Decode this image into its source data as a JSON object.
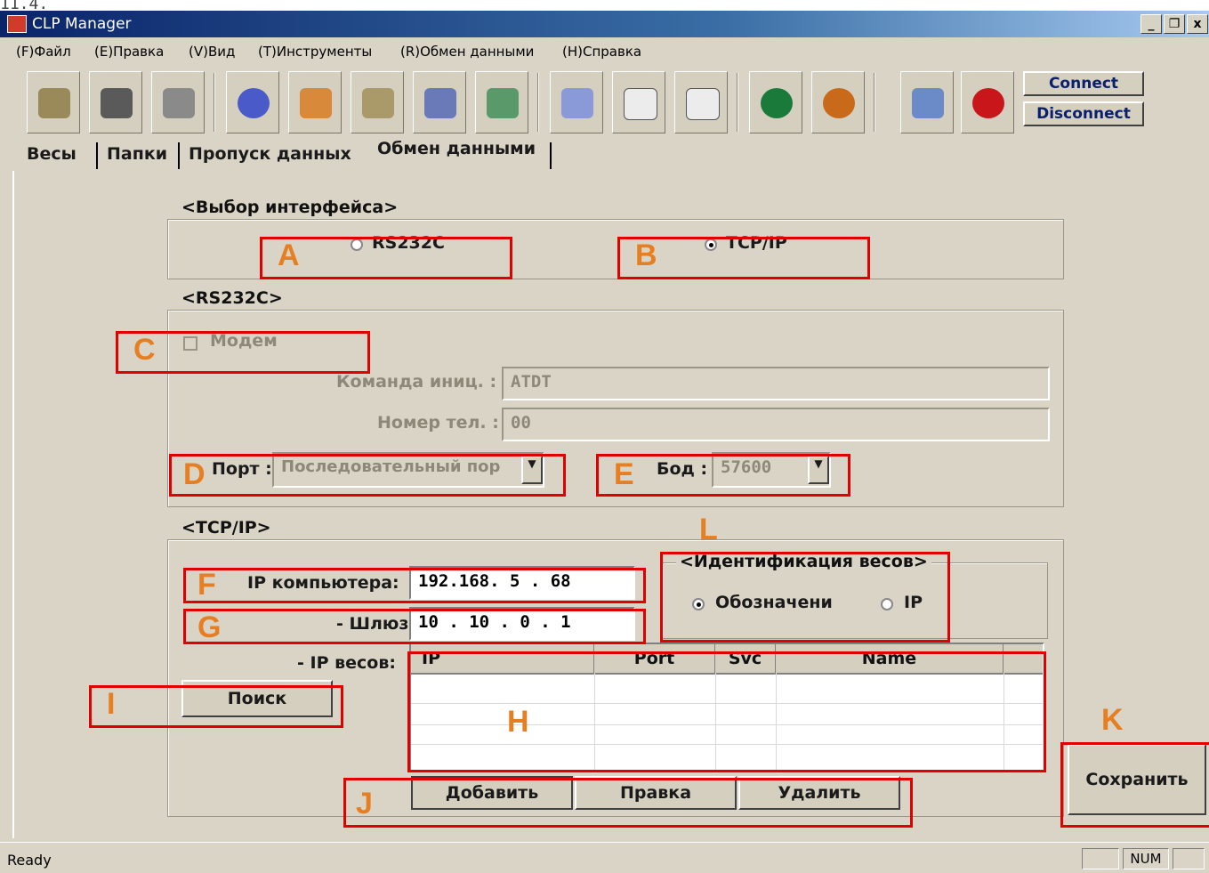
{
  "top_note": "11.4.",
  "window": {
    "title": "CLP Manager",
    "controls": [
      "_",
      "ن",
      "x"
    ]
  },
  "menu": [
    "(F)Файл",
    "(E)Правка",
    "(V)Вид",
    "(T)Инструменты",
    "(R)Обмен данными",
    "(H)Справка"
  ],
  "toolbar": {
    "connect_label": "Connect",
    "disconnect_label": "Disconnect"
  },
  "tabs": [
    "Весы",
    "Папки",
    "Пропуск данных",
    "Обмен данными"
  ],
  "interface_group": {
    "legend": "<Выбор интерфейса>",
    "rs232c_label": "RS232C",
    "tcpip_label": "TCP/IP",
    "selected": "TCP/IP"
  },
  "rs232c_group": {
    "legend": "<RS232C>",
    "modem_label": "Модем",
    "init_command_label": "Команда иниц. :",
    "init_command_value": "ATDT",
    "phone_label": "Номер тел. :",
    "phone_value": "00",
    "port_label": "Порт :",
    "port_value": "Последовательный пор",
    "baud_label": "Бод :",
    "baud_value": "57600"
  },
  "tcpip_group": {
    "legend": "<TCP/IP>",
    "pc_ip_label": "IP компьютера:",
    "pc_ip_value": "192.168. 5 . 68",
    "gateway_label": "- Шлюз:",
    "gateway_value": "10 . 10 . 0 . 1",
    "scale_ip_label": "- IP весов:",
    "search_button": "Поиск",
    "grid_columns": [
      "IP",
      "Port",
      "Svc",
      "Name"
    ],
    "add_button": "Добавить",
    "edit_button": "Правка",
    "delete_button": "Удалить",
    "identification": {
      "legend": "<Идентификация весов>",
      "name_label": "Обозначени",
      "ip_label": "IP",
      "selected": "Обозначени"
    }
  },
  "save_button": "Сохранить",
  "callouts": [
    "A",
    "B",
    "C",
    "D",
    "E",
    "F",
    "G",
    "H",
    "I",
    "J",
    "K",
    "L"
  ],
  "status": {
    "text": "Ready",
    "num": "NUM"
  },
  "colors": {
    "callout_border": "#e00000",
    "callout_letter": "#e67e22",
    "panel_bg": "#d9d4c6"
  }
}
